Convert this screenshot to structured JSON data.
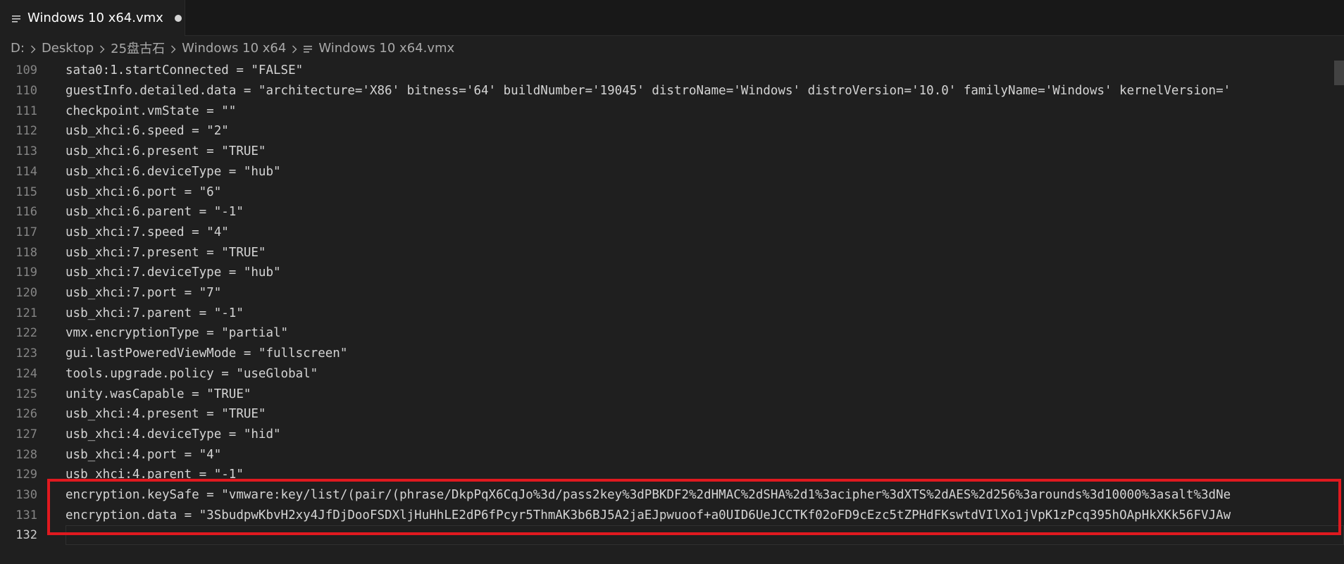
{
  "tab": {
    "label": "Windows 10 x64.vmx",
    "icon": "lines-icon"
  },
  "breadcrumb": {
    "items": [
      "D:",
      "Desktop",
      "25盘古石",
      "Windows 10 x64"
    ],
    "file": "Windows 10 x64.vmx"
  },
  "colors": {
    "highlight": "#e0191f",
    "text": "#d4d4d4",
    "line_number": "#858585"
  },
  "lines": [
    {
      "num": "109",
      "text": "sata0:1.startConnected = \"FALSE\""
    },
    {
      "num": "110",
      "text": "guestInfo.detailed.data = \"architecture='X86' bitness='64' buildNumber='19045' distroName='Windows' distroVersion='10.0' familyName='Windows' kernelVersion='"
    },
    {
      "num": "111",
      "text": "checkpoint.vmState = \"\""
    },
    {
      "num": "112",
      "text": "usb_xhci:6.speed = \"2\""
    },
    {
      "num": "113",
      "text": "usb_xhci:6.present = \"TRUE\""
    },
    {
      "num": "114",
      "text": "usb_xhci:6.deviceType = \"hub\""
    },
    {
      "num": "115",
      "text": "usb_xhci:6.port = \"6\""
    },
    {
      "num": "116",
      "text": "usb_xhci:6.parent = \"-1\""
    },
    {
      "num": "117",
      "text": "usb_xhci:7.speed = \"4\""
    },
    {
      "num": "118",
      "text": "usb_xhci:7.present = \"TRUE\""
    },
    {
      "num": "119",
      "text": "usb_xhci:7.deviceType = \"hub\""
    },
    {
      "num": "120",
      "text": "usb_xhci:7.port = \"7\""
    },
    {
      "num": "121",
      "text": "usb_xhci:7.parent = \"-1\""
    },
    {
      "num": "122",
      "text": "vmx.encryptionType = \"partial\""
    },
    {
      "num": "123",
      "text": "gui.lastPoweredViewMode = \"fullscreen\""
    },
    {
      "num": "124",
      "text": "tools.upgrade.policy = \"useGlobal\""
    },
    {
      "num": "125",
      "text": "unity.wasCapable = \"TRUE\""
    },
    {
      "num": "126",
      "text": "usb_xhci:4.present = \"TRUE\""
    },
    {
      "num": "127",
      "text": "usb_xhci:4.deviceType = \"hid\""
    },
    {
      "num": "128",
      "text": "usb_xhci:4.port = \"4\""
    },
    {
      "num": "129",
      "text": "usb_xhci:4.parent = \"-1\""
    },
    {
      "num": "130",
      "text": "encryption.keySafe = \"vmware:key/list/(pair/(phrase/DkpPqX6CqJo%3d/pass2key%3dPBKDF2%2dHMAC%2dSHA%2d1%3acipher%3dXTS%2dAES%2d256%3arounds%3d10000%3asalt%3dNe"
    },
    {
      "num": "131",
      "text": "encryption.data = \"3SbudpwKbvH2xy4JfDjDooFSDXljHuHhLE2dP6fPcyr5ThmAK3b6BJ5A2jaEJpwuoof+a0UID6UeJCCTKf02oFD9cEzc5tZPHdFKswtdVIlXo1jVpK1zPcq395hOApHkXKk56FVJAw"
    },
    {
      "num": "132",
      "text": ""
    }
  ]
}
